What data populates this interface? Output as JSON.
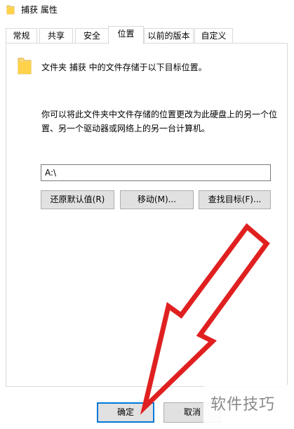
{
  "window": {
    "title": "捕获 属性",
    "icon": "folder-icon"
  },
  "tabs": [
    {
      "label": "常规",
      "active": false
    },
    {
      "label": "共享",
      "active": false
    },
    {
      "label": "安全",
      "active": false
    },
    {
      "label": "位置",
      "active": true
    },
    {
      "label": "以前的版本",
      "active": false
    },
    {
      "label": "自定义",
      "active": false
    }
  ],
  "location": {
    "folder_icon": "folder-icon",
    "info": "文件夹 捕获 中的文件存储于以下目标位置。",
    "description": "你可以将此文件夹中文件存储的位置更改为此硬盘上的另一个位置、另一个驱动器或网络上的另一台计算机。",
    "path_value": "A:\\",
    "buttons": {
      "restore": "还原默认值(R)",
      "move": "移动(M)...",
      "find": "查找目标(F)..."
    }
  },
  "footer": {
    "ok": "确定",
    "cancel": "取消"
  },
  "annotation": {
    "type": "red-arrow",
    "color": "#e02020",
    "points_to": "ok-button"
  },
  "watermark": {
    "text": "软件技巧"
  }
}
